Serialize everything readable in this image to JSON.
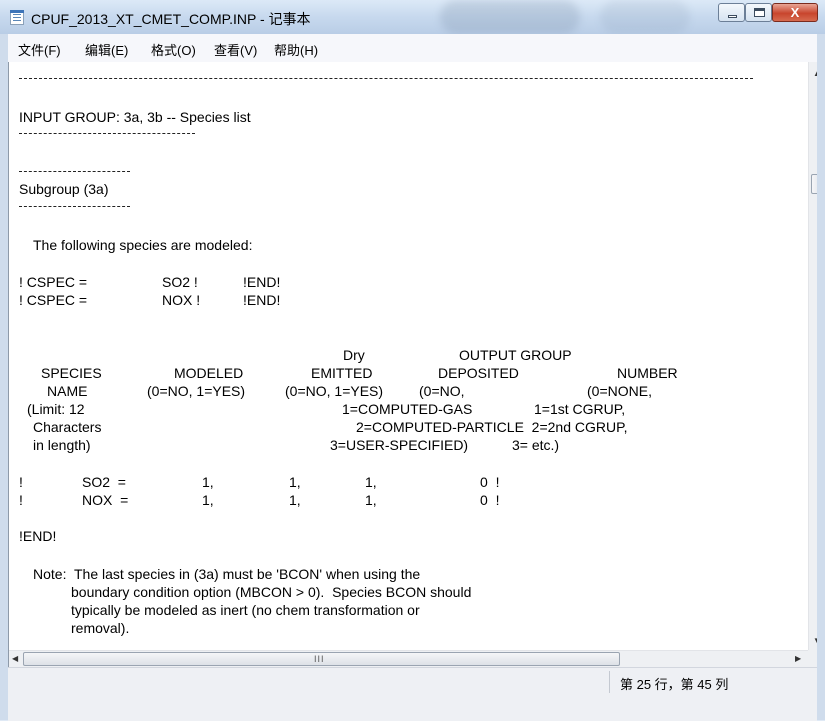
{
  "window": {
    "title": "CPUF_2013_XT_CMET_COMP.INP - 记事本",
    "close_glyph": "X"
  },
  "menu": [
    "文件(F)",
    "编辑(E)",
    "格式(O)",
    "查看(V)",
    "帮助(H)"
  ],
  "document": {
    "group_title": "INPUT GROUP: 3a, 3b -- Species list",
    "subgroup_title": "Subgroup (3a)",
    "intro": "The following species are modeled:",
    "cspec_lines": [
      {
        "prefix": "! CSPEC =",
        "name": "SO2 !",
        "end": "!END!"
      },
      {
        "prefix": "! CSPEC =",
        "name": "NOX !",
        "end": "!END!"
      }
    ],
    "header_rows": [
      [
        {
          "t": "Dry"
        },
        {
          "t": "OUTPUT GROUP"
        }
      ],
      [
        {
          "t": "SPECIES"
        },
        {
          "t": "MODELED"
        },
        {
          "t": "EMITTED"
        },
        {
          "t": "DEPOSITED"
        },
        {
          "t": "NUMBER"
        }
      ],
      [
        {
          "t": "NAME"
        },
        {
          "t": "(0=NO, 1=YES)"
        },
        {
          "t": "(0=NO, 1=YES)"
        },
        {
          "t": "(0=NO,"
        },
        {
          "t": "(0=NONE,"
        }
      ],
      [
        {
          "t": "(Limit: 12"
        },
        {
          "t": "1=COMPUTED-GAS"
        },
        {
          "t": "1=1st CGRUP,"
        }
      ],
      [
        {
          "t": "Characters"
        },
        {
          "t": "2=COMPUTED-PARTICLE  2=2nd CGRUP,"
        }
      ],
      [
        {
          "t": "in length)"
        },
        {
          "t": "3=USER-SPECIFIED)"
        },
        {
          "t": "3= etc.)"
        }
      ]
    ],
    "species_rows": [
      {
        "bang": "!",
        "name": "SO2  =",
        "modeled": "1,",
        "emitted": "1,",
        "deposited": "1,",
        "group": "0  !"
      },
      {
        "bang": "!",
        "name": "NOX  =",
        "modeled": "1,",
        "emitted": "1,",
        "deposited": "1,",
        "group": "0  !"
      }
    ],
    "end_marker": "!END!",
    "note_lines": [
      "Note:  The last species in (3a) must be 'BCON' when using the",
      "boundary condition option (MBCON > 0).  Species BCON should",
      "typically be modeled as inert (no chem transformation or",
      "removal)."
    ]
  },
  "scrollbars": {
    "up": "▲",
    "down": "▼",
    "left": "◀",
    "right": "▶",
    "grip": "III"
  },
  "status": {
    "position": "第 25 行，第 45 列"
  }
}
